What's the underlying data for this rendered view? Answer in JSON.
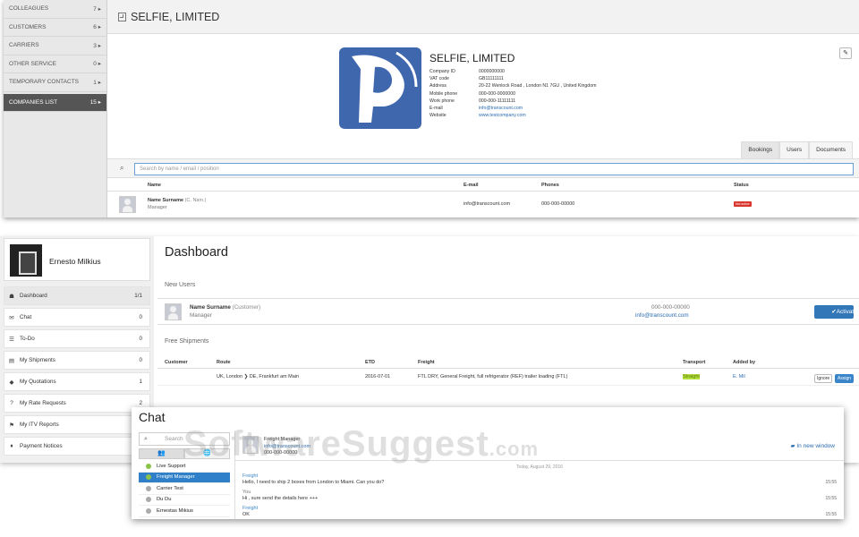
{
  "top": {
    "sidebar": [
      {
        "label": "COLLEAGUES",
        "count": "7"
      },
      {
        "label": "CUSTOMERS",
        "count": "6"
      },
      {
        "label": "CARRIERS",
        "count": "3"
      },
      {
        "label": "OTHER SERVICE",
        "count": "0"
      },
      {
        "label": "TEMPORARY CONTACTS",
        "count": "1"
      },
      {
        "label": "COMPANIES LIST",
        "count": "15"
      }
    ],
    "header_title": "SELFIE, LIMITED",
    "company": {
      "name": "SELFIE, LIMITED",
      "fields": [
        {
          "k": "Company ID",
          "v": "0000000000"
        },
        {
          "k": "VAT code",
          "v": "GB11111111"
        },
        {
          "k": "Address",
          "v": "20-22 Wenlock Road , London N1 7GU , United Kingdom"
        },
        {
          "k": "Mobile phone",
          "v": "000-000-0000000"
        },
        {
          "k": "Work phone",
          "v": "000-000-11111111"
        },
        {
          "k": "E-mail",
          "v": "info@transcount.com"
        },
        {
          "k": "Website",
          "v": "www.testcompany.com"
        }
      ]
    },
    "tabs": [
      "Bookings",
      "Users",
      "Documents"
    ],
    "search_placeholder": "Search by name / email / position",
    "table": {
      "headers": [
        "Name",
        "E-mail",
        "Phones",
        "Status"
      ],
      "row": {
        "name": "Name Surname",
        "alias": "(C. Nam.)",
        "role": "Manager",
        "email": "info@transcount.com",
        "phone": "000-000-00000",
        "status": "Not active"
      }
    }
  },
  "middle": {
    "user_name": "Ernesto Milkius",
    "nav": [
      {
        "icon": "☗",
        "label": "Dashboard",
        "count": "1/1"
      },
      {
        "icon": "✉",
        "label": "Chat",
        "count": "0"
      },
      {
        "icon": "☰",
        "label": "To-Do",
        "count": "0"
      },
      {
        "icon": "▤",
        "label": "My Shipments",
        "count": "0"
      },
      {
        "icon": "◆",
        "label": "My Quotations",
        "count": "1"
      },
      {
        "icon": "?",
        "label": "My Rate Requests",
        "count": "2"
      },
      {
        "icon": "⚑",
        "label": "My ITV Reports",
        "count": ""
      },
      {
        "icon": "♦",
        "label": "Payment Notices",
        "count": ""
      }
    ],
    "title": "Dashboard",
    "new_users_label": "New Users",
    "new_user": {
      "name": "Name Surname",
      "type": "(Customer)",
      "role": "Manager",
      "phone": "000-000-00000",
      "email": "info@transcount.com",
      "action": "Activate"
    },
    "free_shipments_label": "Free Shipments",
    "fs_headers": [
      "Customer",
      "Route",
      "ETD",
      "Freight",
      "Transport",
      "Added by"
    ],
    "fs_row": {
      "customer": "",
      "route": "UK, London ❯ DE, Frankfurt am Main",
      "etd": "2016-07-01",
      "freight": "FTL DRY, General Freight, full refrigerator (REF) trailer loading (FTL)",
      "transport": "Straight",
      "added_by": "E. Mil",
      "ignore": "Ignore",
      "assign": "Assign"
    }
  },
  "chat": {
    "title": "Chat",
    "search_placeholder": "Search",
    "contacts": [
      {
        "name": "Live Support",
        "color": "#8bc34a"
      },
      {
        "name": "Freight Manager",
        "color": "#8bc34a"
      },
      {
        "name": "Carrier Test",
        "color": "#aaaaaa"
      },
      {
        "name": "Du Du",
        "color": "#aaaaaa"
      },
      {
        "name": "Ernestas Mikius",
        "color": "#aaaaaa"
      }
    ],
    "header": {
      "name": "Freight Manager",
      "email": "info@transcount.com",
      "phone": "000-000-00000"
    },
    "new_window": "In new window",
    "date": "Today, August 29, 2016",
    "messages": [
      {
        "who": "Freight",
        "text": "Hello, I need to ship 2 boxes from London to Miami. Can you do?",
        "time": "15:55"
      },
      {
        "who": "You",
        "text": "Hi , sure send the details here +++",
        "time": "15:55"
      },
      {
        "who": "Freight",
        "text": "OK",
        "time": "15:55"
      }
    ]
  },
  "watermark": {
    "main": "SoftwareSuggest",
    "tld": ".com"
  }
}
